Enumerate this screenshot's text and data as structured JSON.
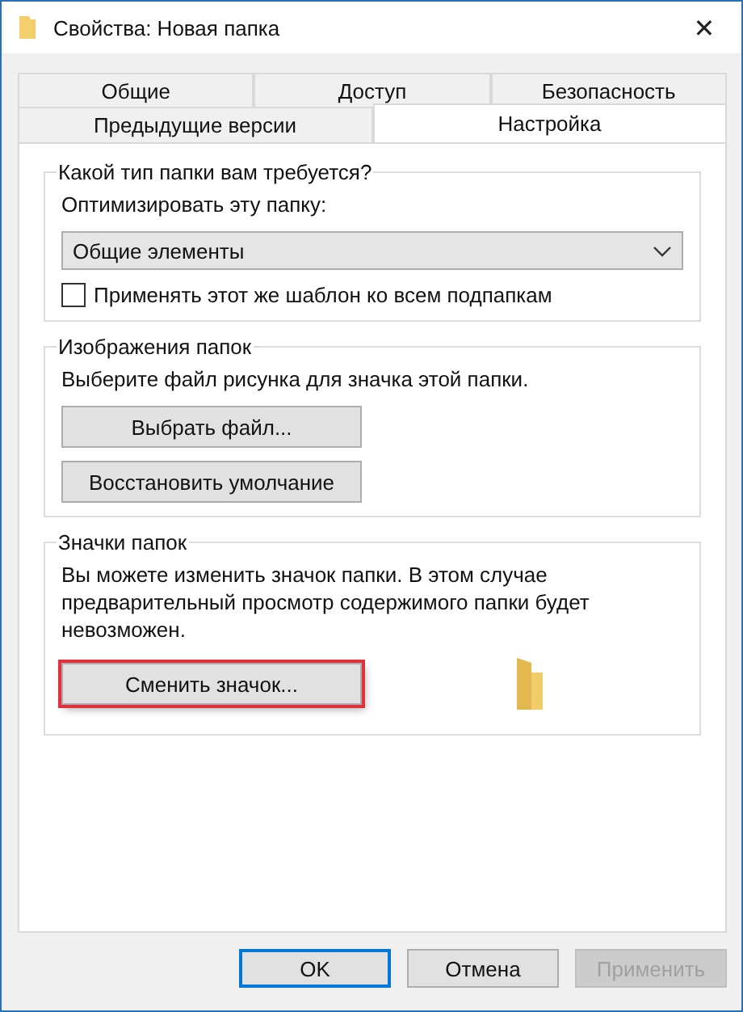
{
  "window": {
    "title": "Свойства: Новая папка",
    "close": "✕"
  },
  "tab_rows": [
    [
      {
        "label": "Общие",
        "selected": false
      },
      {
        "label": "Доступ",
        "selected": false
      },
      {
        "label": "Безопасность",
        "selected": false
      }
    ],
    [
      {
        "label": "Предыдущие версии",
        "selected": false
      },
      {
        "label": "Настройка",
        "selected": true
      }
    ]
  ],
  "groups": [
    {
      "title": "Какой тип папки вам требуется?",
      "items": [
        {
          "kind": "label",
          "text": "Оптимизировать эту папку:"
        },
        {
          "kind": "dropdown",
          "value": "Общие элементы"
        },
        {
          "kind": "checkbox",
          "text": "Применять этот же шаблон ко всем подпапкам",
          "checked": false
        }
      ]
    },
    {
      "title": "Изображения папок",
      "items": [
        {
          "kind": "label",
          "text": "Выберите файл рисунка для значка этой папки."
        },
        {
          "kind": "button",
          "text": "Выбрать файл...",
          "highlighted": false
        },
        {
          "kind": "button",
          "text": "Восстановить умолчание",
          "highlighted": false
        }
      ]
    },
    {
      "title": "Значки папок",
      "items": [
        {
          "kind": "label",
          "text": "Вы можете изменить значок папки. В этом случае предварительный просмотр содержимого папки будет невозможен."
        },
        {
          "kind": "icon-button",
          "text": "Сменить значок...",
          "highlighted": true
        }
      ]
    }
  ],
  "buttons": [
    {
      "label": "OK",
      "default": true,
      "disabled": false
    },
    {
      "label": "Отмена",
      "default": false,
      "disabled": false
    },
    {
      "label": "Применить",
      "default": false,
      "disabled": true
    }
  ]
}
